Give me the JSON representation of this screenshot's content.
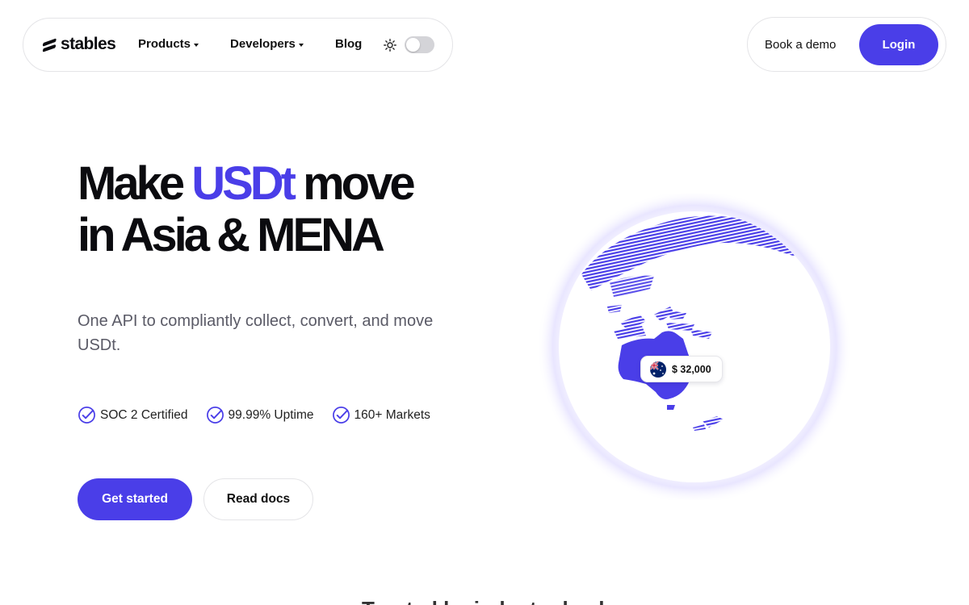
{
  "brand": {
    "name": "stables",
    "accent": "#4a3ee8"
  },
  "nav": {
    "items": [
      {
        "label": "Products",
        "has_dropdown": true
      },
      {
        "label": "Developers",
        "has_dropdown": true
      },
      {
        "label": "Blog",
        "has_dropdown": false
      }
    ],
    "theme_toggle": {
      "icon": "sun-icon",
      "state": "off"
    }
  },
  "auth": {
    "demo_label": "Book a demo",
    "login_label": "Login"
  },
  "hero": {
    "title_part1": "Make ",
    "title_accent": "USDt",
    "title_part2": " move",
    "title_line2": "in Asia & MENA",
    "subtitle": "One API to compliantly collect, convert, and move USDt.",
    "badges": [
      "SOC 2 Certified",
      "99.99% Uptime",
      "160+ Markets"
    ],
    "primary_cta": "Get started",
    "secondary_cta": "Read docs"
  },
  "globe": {
    "chip_amount": "$ 32,000",
    "chip_flag": "australia-flag-icon"
  },
  "footer_peek": {
    "text": "Trusted by industry leaders"
  }
}
